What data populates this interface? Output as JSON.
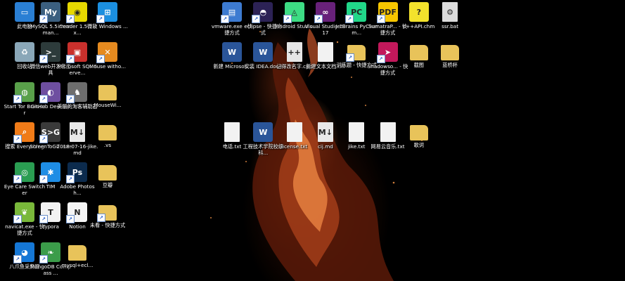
{
  "colors": {
    "desktop_bg": "#000000",
    "label_text": "#ffffff"
  },
  "icons": [
    {
      "id": "this-pc",
      "label": "此电脑",
      "icon": "monitor-icon",
      "color": "#2a7fd4",
      "glyph": "▭",
      "shortcut": false,
      "col": 0,
      "row": 0
    },
    {
      "id": "mysql",
      "label": "MySQL 5.5 Comman...",
      "icon": "mysql-icon",
      "color": "#3b5f7f",
      "glyph": "My",
      "shortcut": true,
      "col": 1,
      "row": 0
    },
    {
      "id": "irreader",
      "label": "irreader 1.5.7.ex...",
      "icon": "irreader-icon",
      "color": "#e6d800",
      "glyph": "◉",
      "shortcut": true,
      "col": 2,
      "row": 0
    },
    {
      "id": "windows",
      "label": "微软 Windows ...",
      "icon": "windows-logo-icon",
      "color": "#1b8fe0",
      "glyph": "⊞",
      "shortcut": true,
      "col": 3,
      "row": 0
    },
    {
      "id": "recycle-bin",
      "label": "回收站",
      "icon": "recycle-bin-icon",
      "color": "#8aa7b8",
      "glyph": "♻",
      "shortcut": false,
      "col": 0,
      "row": 1
    },
    {
      "id": "wechat-devtools",
      "label": "微信web开发者工具",
      "icon": "terminal-icon",
      "color": "#2d3b3b",
      "glyph": ">_",
      "shortcut": true,
      "col": 1,
      "row": 1
    },
    {
      "id": "sqlserver",
      "label": "Microsoft SQL Serve...",
      "icon": "sqlserver-icon",
      "color": "#c9302c",
      "glyph": "▣",
      "shortcut": true,
      "col": 2,
      "row": 1
    },
    {
      "id": "mouse-without",
      "label": "Mouse witho...",
      "icon": "mouse-without-borders-icon",
      "color": "#e58a1f",
      "glyph": "✕",
      "shortcut": true,
      "col": 3,
      "row": 1
    },
    {
      "id": "tor",
      "label": "Start Tor Browser",
      "icon": "tor-globe-icon",
      "color": "#59a04a",
      "glyph": "◍",
      "shortcut": true,
      "col": 0,
      "row": 2
    },
    {
      "id": "github",
      "label": "GitHub Desktop",
      "icon": "github-icon",
      "color": "#6e4fa0",
      "glyph": "◐",
      "shortcut": true,
      "col": 1,
      "row": 2
    },
    {
      "id": "meitu",
      "label": "美丽的淘客辅助器",
      "icon": "app-icon",
      "color": "#6d6d6d",
      "glyph": "♞",
      "shortcut": true,
      "col": 2,
      "row": 2
    },
    {
      "id": "mousewi",
      "label": "MouseWi...",
      "icon": "folder-icon",
      "color": "#e8c35a",
      "glyph": "",
      "shortcut": false,
      "col": 3,
      "row": 2
    },
    {
      "id": "everything",
      "label": "搜索 Everything",
      "icon": "search-icon",
      "color": "#f07b18",
      "glyph": "⌕",
      "shortcut": true,
      "col": 0,
      "row": 3
    },
    {
      "id": "screentogif",
      "label": "ScreenToGif .exe",
      "icon": "screentogif-icon",
      "color": "#3a3a3a",
      "glyph": "S>G",
      "shortcut": true,
      "col": 1,
      "row": 3
    },
    {
      "id": "jike-md",
      "label": "2018-07-16-jike.md",
      "icon": "markdown-file-icon",
      "color": "#e8e8e8",
      "glyph": "M↓",
      "shortcut": false,
      "col": 2,
      "row": 3
    },
    {
      "id": "vs-folder",
      "label": ".vs",
      "icon": "folder-icon",
      "color": "#e8c35a",
      "glyph": "",
      "shortcut": false,
      "col": 3,
      "row": 3
    },
    {
      "id": "eyecare",
      "label": "Eye Care Switcher",
      "icon": "eye-icon",
      "color": "#2a9d52",
      "glyph": "◎",
      "shortcut": true,
      "col": 0,
      "row": 4
    },
    {
      "id": "tim",
      "label": "TIM",
      "icon": "tim-icon",
      "color": "#1e8de5",
      "glyph": "✱",
      "shortcut": true,
      "col": 1,
      "row": 4
    },
    {
      "id": "photoshop",
      "label": "Adobe Photosh...",
      "icon": "photoshop-icon",
      "color": "#0c2b4d",
      "glyph": "Ps",
      "shortcut": true,
      "col": 2,
      "row": 4
    },
    {
      "id": "douban",
      "label": "豆瓣",
      "icon": "folder-icon",
      "color": "#e8c35a",
      "glyph": "",
      "shortcut": false,
      "col": 3,
      "row": 4
    },
    {
      "id": "navicat",
      "label": "navicat.exe - 快捷方式",
      "icon": "navicat-icon",
      "color": "#79b83a",
      "glyph": "❦",
      "shortcut": true,
      "col": 0,
      "row": 5
    },
    {
      "id": "typora",
      "label": "Typora",
      "icon": "typora-icon",
      "color": "#f2f2f2",
      "glyph": "T",
      "shortcut": true,
      "col": 1,
      "row": 5
    },
    {
      "id": "notion",
      "label": "Notion",
      "icon": "notion-icon",
      "color": "#f5f5f5",
      "glyph": "N",
      "shortcut": true,
      "col": 2,
      "row": 5
    },
    {
      "id": "weikan",
      "label": "未看 - 快捷方式",
      "icon": "folder-shortcut-icon",
      "color": "#e8c35a",
      "glyph": "",
      "shortcut": true,
      "col": 3,
      "row": 5
    },
    {
      "id": "bazhuayu",
      "label": "八爪鱼采集器",
      "icon": "octopus-icon",
      "color": "#1577d6",
      "glyph": "◕",
      "shortcut": true,
      "col": 0,
      "row": 6
    },
    {
      "id": "mongodb",
      "label": "MongoDB Compass ...",
      "icon": "mongodb-leaf-icon",
      "color": "#3b9c4a",
      "glyph": "❧",
      "shortcut": true,
      "col": 1,
      "row": 6
    },
    {
      "id": "mysql-ecl",
      "label": "mysql+ecl...",
      "icon": "folder-icon",
      "color": "#e8c35a",
      "glyph": "",
      "shortcut": false,
      "col": 2,
      "row": 6
    },
    {
      "id": "vmware",
      "label": "vmware.exe - 快捷方式",
      "icon": "vmware-icon",
      "color": "#3d7bd1",
      "glyph": "▤",
      "shortcut": true,
      "col": 5,
      "row": 0
    },
    {
      "id": "eclipse",
      "label": "eclipse - 快捷方式",
      "icon": "eclipse-icon",
      "color": "#2c2255",
      "glyph": "◓",
      "shortcut": true,
      "col": 6,
      "row": 0
    },
    {
      "id": "android-studio",
      "label": "Android Studio",
      "icon": "android-studio-icon",
      "color": "#3ddc84",
      "glyph": "◬",
      "shortcut": true,
      "col": 7,
      "row": 0
    },
    {
      "id": "visual-studio",
      "label": "Visual Studio 2017",
      "icon": "visual-studio-icon",
      "color": "#68217a",
      "glyph": "∞",
      "shortcut": true,
      "col": 8,
      "row": 0
    },
    {
      "id": "pycharm",
      "label": "JetBrains PyCharm...",
      "icon": "pycharm-icon",
      "color": "#21d789",
      "glyph": "PC",
      "shortcut": true,
      "col": 9,
      "row": 0
    },
    {
      "id": "sumatrapdf",
      "label": "SumatraP... - 快捷方式",
      "icon": "pdf-icon",
      "color": "#f7c600",
      "glyph": "PDF",
      "shortcut": true,
      "col": 10,
      "row": 0
    },
    {
      "id": "cpp-chm",
      "label": "c++API.chm",
      "icon": "help-file-icon",
      "color": "#f3e22c",
      "glyph": "?",
      "shortcut": false,
      "col": 11,
      "row": 0
    },
    {
      "id": "ssr-bat",
      "label": "ssr.bat",
      "icon": "batch-file-icon",
      "color": "#dcdcdc",
      "glyph": "⚙",
      "shortcut": false,
      "col": 12,
      "row": 0
    },
    {
      "id": "new-word",
      "label": "新建 Microsof...",
      "icon": "word-file-icon",
      "color": "#2a5599",
      "glyph": "W",
      "shortcut": false,
      "col": 5,
      "row": 1
    },
    {
      "id": "idea-docx",
      "label": "安装 IDEA.docx",
      "icon": "word-file-icon",
      "color": "#2a5599",
      "glyph": "W",
      "shortcut": false,
      "col": 6,
      "row": 1
    },
    {
      "id": "cpp-file",
      "label": "记得改名字.cpp",
      "icon": "cpp-file-icon",
      "color": "#e6e6e6",
      "glyph": "++",
      "shortcut": false,
      "col": 7,
      "row": 1
    },
    {
      "id": "new-txt",
      "label": "新建文本文档.txt",
      "icon": "text-file-icon",
      "color": "#f2f2f2",
      "glyph": "",
      "shortcut": false,
      "col": 8,
      "row": 1
    },
    {
      "id": "xunlian",
      "label": "训练题 - 快捷方式",
      "icon": "folder-shortcut-icon",
      "color": "#e8c35a",
      "glyph": "",
      "shortcut": true,
      "col": 9,
      "row": 1
    },
    {
      "id": "shadowsocks",
      "label": "Shadowso... - 快捷方式",
      "icon": "shadowsocks-icon",
      "color": "#c2185b",
      "glyph": "➤",
      "shortcut": true,
      "col": 10,
      "row": 1
    },
    {
      "id": "screenshots",
      "label": "截图",
      "icon": "folder-icon",
      "color": "#e8c35a",
      "glyph": "",
      "shortcut": false,
      "col": 11,
      "row": 1
    },
    {
      "id": "lanqiao",
      "label": "蓝桥杯",
      "icon": "folder-icon",
      "color": "#e8c35a",
      "glyph": "",
      "shortcut": false,
      "col": 12,
      "row": 1
    },
    {
      "id": "dianhua",
      "label": "电话.txt",
      "icon": "text-file-icon",
      "color": "#f2f2f2",
      "glyph": "",
      "shortcut": false,
      "col": 5,
      "row": 3
    },
    {
      "id": "gongcheng",
      "label": "工程技术学院校级科...",
      "icon": "word-file-icon",
      "color": "#2a5599",
      "glyph": "W",
      "shortcut": false,
      "col": 6,
      "row": 3
    },
    {
      "id": "license",
      "label": "license.txt",
      "icon": "text-file-icon",
      "color": "#f2f2f2",
      "glyph": "",
      "shortcut": false,
      "col": 7,
      "row": 3
    },
    {
      "id": "cij-md",
      "label": "cij.md",
      "icon": "markdown-file-icon",
      "color": "#e8e8e8",
      "glyph": "M↓",
      "shortcut": false,
      "col": 8,
      "row": 3
    },
    {
      "id": "jike-txt",
      "label": "jike.txt",
      "icon": "text-file-icon",
      "color": "#f2f2f2",
      "glyph": "",
      "shortcut": false,
      "col": 9,
      "row": 3
    },
    {
      "id": "netease",
      "label": "网易云音乐.txt",
      "icon": "text-file-icon",
      "color": "#f2f2f2",
      "glyph": "",
      "shortcut": false,
      "col": 10,
      "row": 3
    },
    {
      "id": "geci",
      "label": "歌词",
      "icon": "folder-icon",
      "color": "#e8c35a",
      "glyph": "",
      "shortcut": false,
      "col": 11,
      "row": 3
    }
  ]
}
